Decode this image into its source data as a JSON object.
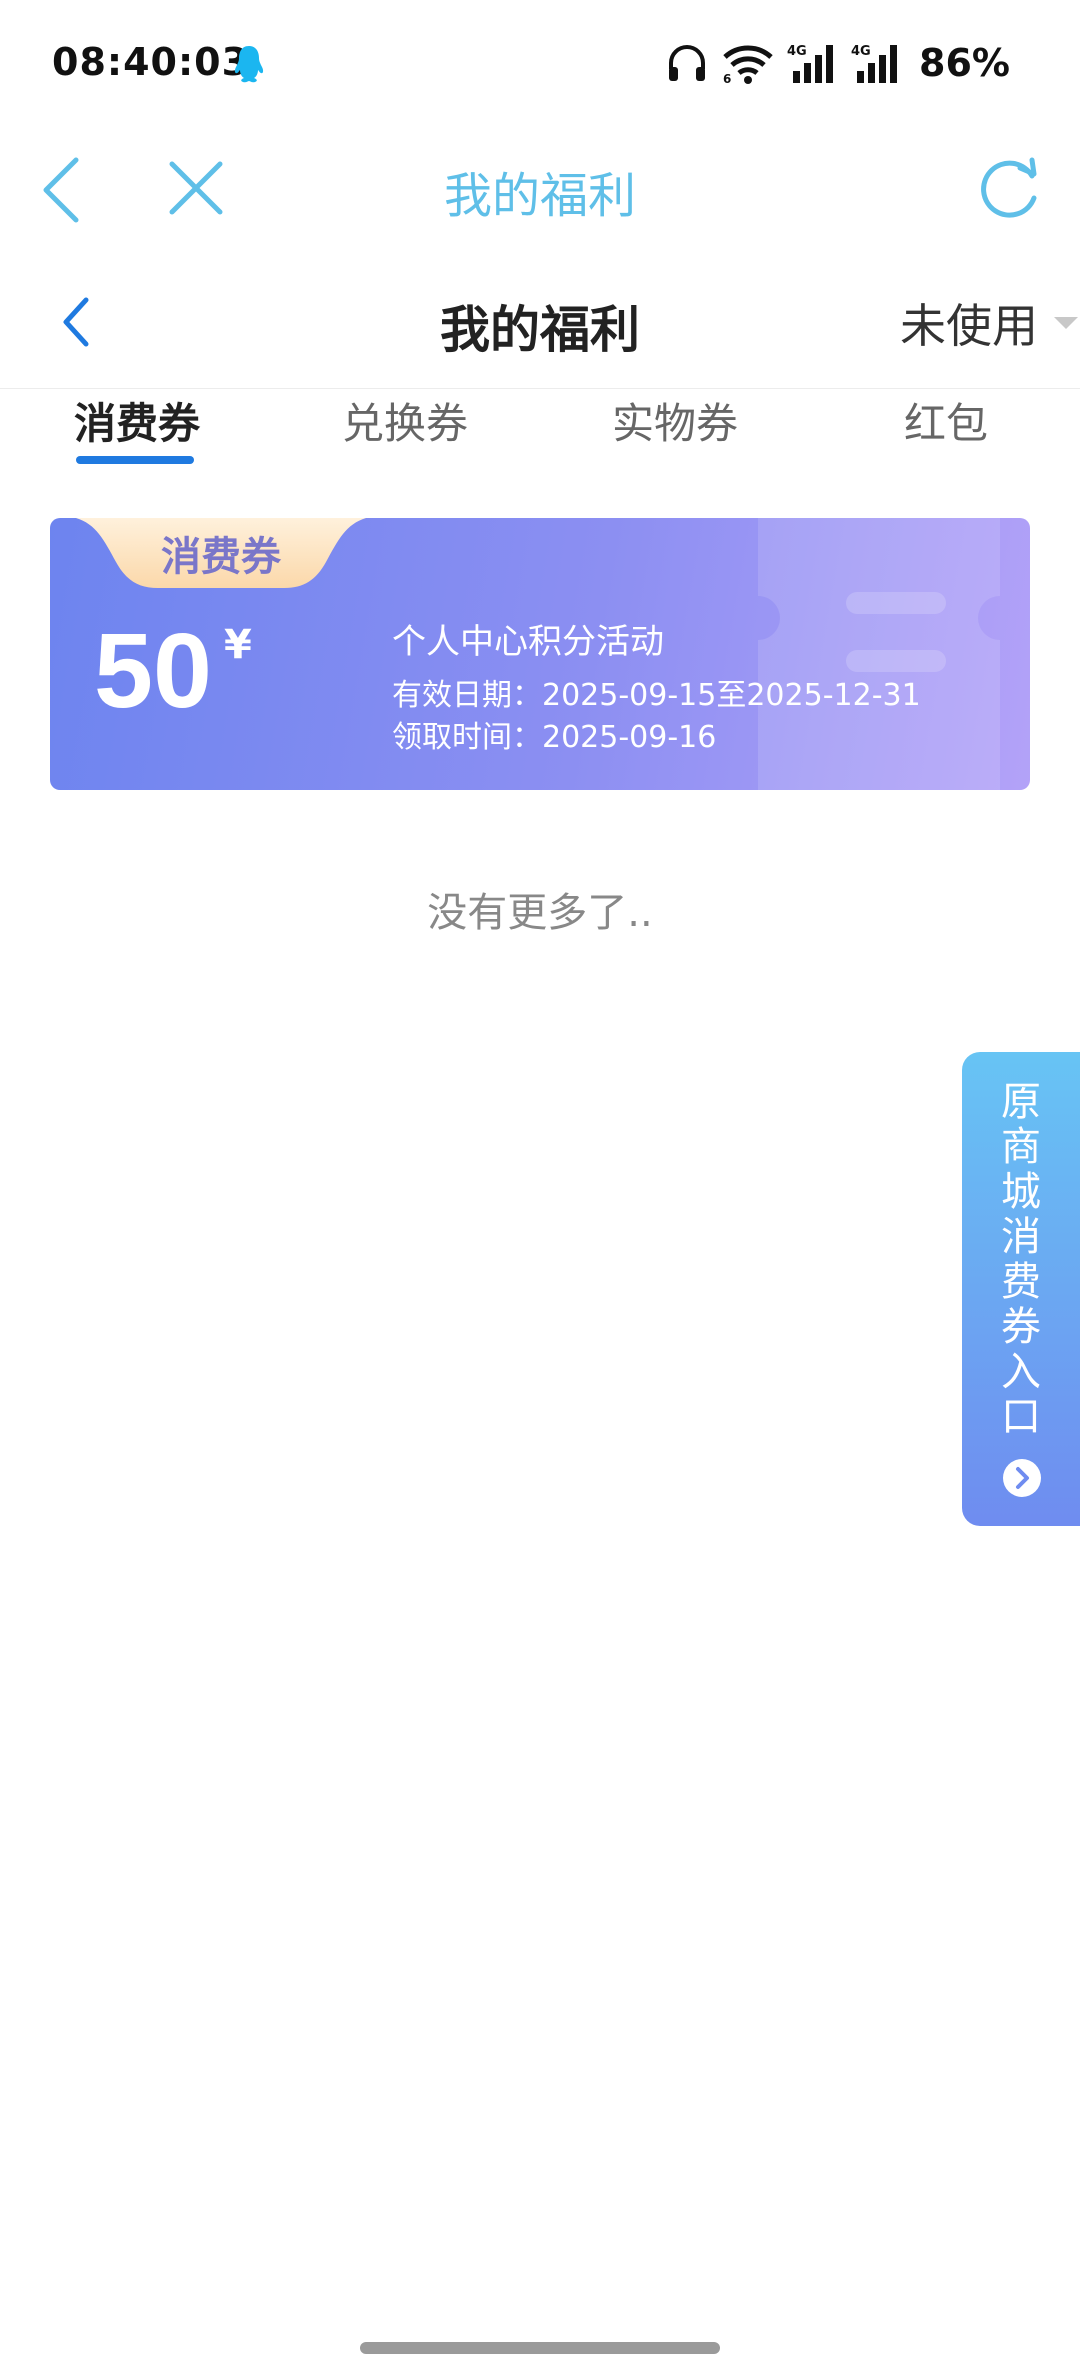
{
  "status_bar": {
    "time": "08:40:03",
    "battery": "86%",
    "network_1": "4G",
    "network_2": "4G"
  },
  "top_bar": {
    "title": "我的福利"
  },
  "header": {
    "title": "我的福利",
    "filter_label": "未使用"
  },
  "tabs": [
    {
      "label": "消费券",
      "active": true
    },
    {
      "label": "兑换券",
      "active": false
    },
    {
      "label": "实物券",
      "active": false
    },
    {
      "label": "红包",
      "active": false
    }
  ],
  "coupon": {
    "tag": "消费券",
    "amount": "50",
    "currency": "¥",
    "name": "个人中心积分活动",
    "valid_period": "有效日期：2025-09-15至2025-12-31",
    "claim_time": "领取时间：2025-09-16"
  },
  "list_end_text": "没有更多了..",
  "side_entry": {
    "chars": [
      "原",
      "商",
      "城",
      "消",
      "费",
      "券",
      "入",
      "口"
    ]
  },
  "colors": {
    "accent_blue": "#1f7ae0",
    "top_title": "#5fbfe8",
    "coupon_start": "#6d84ef",
    "coupon_end": "#b3a2f8",
    "tag_bg": "#fde3c0"
  }
}
